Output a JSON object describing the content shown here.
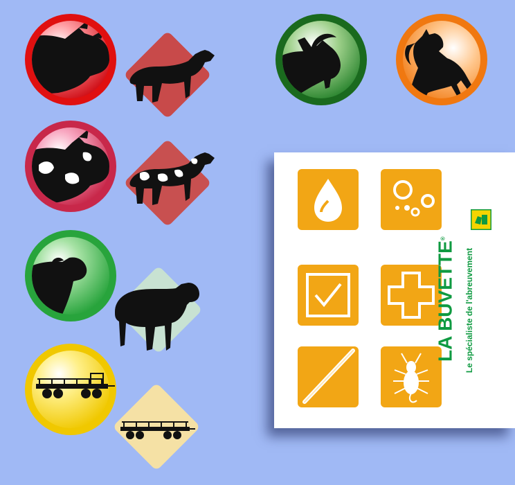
{
  "background_color": "#a0b9f5",
  "icons_left": [
    {
      "animal": "cow-icon",
      "circle_color": "#e01010",
      "diamond_color": "#c84a4a"
    },
    {
      "animal": "spotted-cow-icon",
      "circle_color": "#c8284a",
      "diamond_color": "#c85050"
    },
    {
      "animal": "sheep-icon",
      "circle_color": "#28a43c",
      "diamond_color": "#c8e2d2"
    },
    {
      "animal": "hay-trailer-icon",
      "circle_color": "#f0c800",
      "diamond_color": "#f5e1a5"
    }
  ],
  "icons_top": [
    {
      "animal": "goat-icon",
      "circle_color": "#1a7a22"
    },
    {
      "animal": "horse-icon",
      "circle_color": "#f07810"
    }
  ],
  "card": {
    "tile_color": "#f2a615",
    "tiles": [
      "water-drop-icon",
      "bubbles-icon",
      "checkbox-icon",
      "medical-cross-icon",
      "rod-icon",
      "parasite-icon"
    ],
    "brand": {
      "name": "LA BUVETTE",
      "registered": "®",
      "tagline": "Le spécialiste de l'abreuvement",
      "color": "#0f9a41",
      "logo_color": "#f5d400"
    }
  }
}
